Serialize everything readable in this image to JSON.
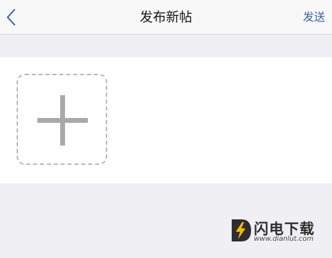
{
  "nav": {
    "back_icon": "chevron-left-icon",
    "title": "发布新帖",
    "send_label": "发送"
  },
  "attachments": {
    "add_icon": "plus-icon"
  },
  "watermark": {
    "brand": "闪电下载",
    "url": "www.dianlut.com",
    "logo_icon": "lightning-d-logo"
  },
  "colors": {
    "accent": "#3a5fa8",
    "background": "#efeff4",
    "panel": "#ffffff",
    "plus": "#a9a9a9",
    "logo_yellow": "#f5b800"
  }
}
